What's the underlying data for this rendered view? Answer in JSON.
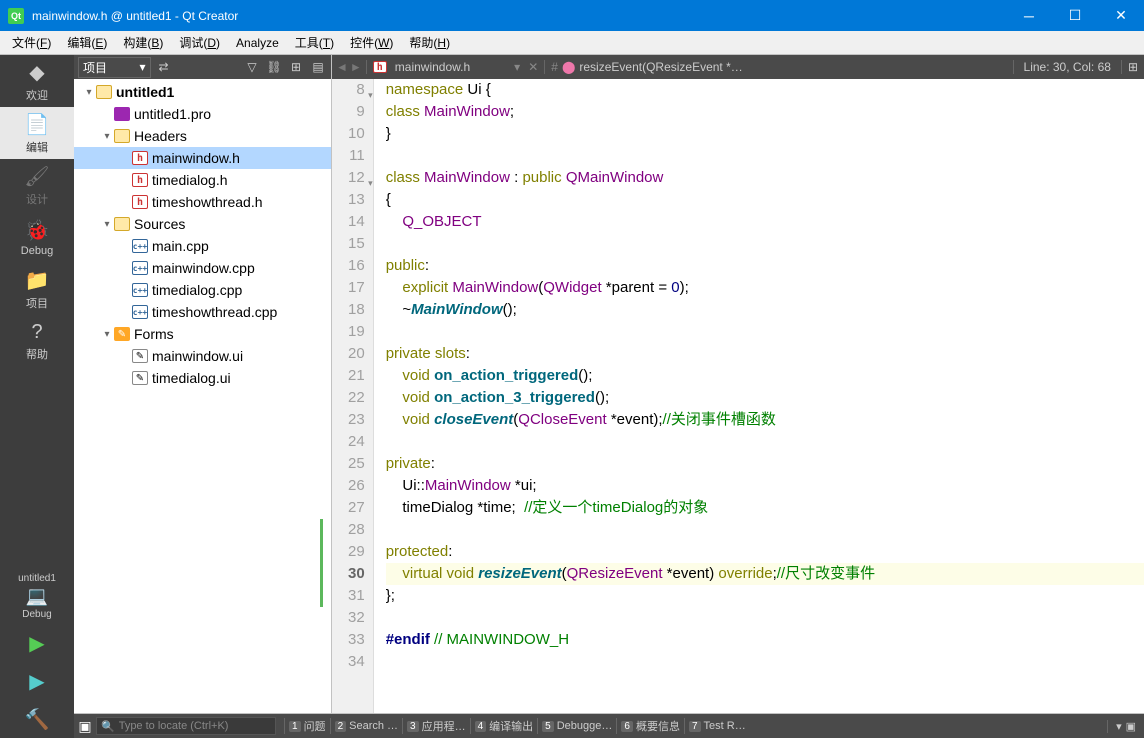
{
  "window": {
    "title": "mainwindow.h @ untitled1 - Qt Creator"
  },
  "menu": {
    "items": [
      "文件(F)",
      "编辑(E)",
      "构建(B)",
      "调试(D)",
      "Analyze",
      "工具(T)",
      "控件(W)",
      "帮助(H)"
    ]
  },
  "modes": {
    "items": [
      {
        "icon": "◆",
        "label": "欢迎",
        "id": "welcome"
      },
      {
        "icon": "📄",
        "label": "编辑",
        "id": "edit",
        "selected": true
      },
      {
        "icon": "🖌",
        "label": "设计",
        "id": "design",
        "dim": true
      },
      {
        "icon": "🐞",
        "label": "Debug",
        "id": "debug"
      },
      {
        "icon": "📁",
        "label": "项目",
        "id": "projects"
      },
      {
        "icon": "?",
        "label": "帮助",
        "id": "help"
      }
    ],
    "kit": "untitled1",
    "kit_config": "Debug",
    "run_btns": [
      "▶",
      "▶",
      "🔨"
    ]
  },
  "sidebar": {
    "title": "项目",
    "tree": [
      {
        "depth": 0,
        "chev": "▾",
        "icon": "folder",
        "label": "untitled1",
        "bold": true
      },
      {
        "depth": 1,
        "chev": "",
        "icon": "pro",
        "label": "untitled1.pro"
      },
      {
        "depth": 1,
        "chev": "▾",
        "icon": "folder",
        "label": "Headers"
      },
      {
        "depth": 2,
        "chev": "",
        "icon": "h",
        "label": "mainwindow.h",
        "selected": true
      },
      {
        "depth": 2,
        "chev": "",
        "icon": "h",
        "label": "timedialog.h"
      },
      {
        "depth": 2,
        "chev": "",
        "icon": "h",
        "label": "timeshowthread.h"
      },
      {
        "depth": 1,
        "chev": "▾",
        "icon": "folder",
        "label": "Sources"
      },
      {
        "depth": 2,
        "chev": "",
        "icon": "cpp",
        "label": "main.cpp"
      },
      {
        "depth": 2,
        "chev": "",
        "icon": "cpp",
        "label": "mainwindow.cpp"
      },
      {
        "depth": 2,
        "chev": "",
        "icon": "cpp",
        "label": "timedialog.cpp"
      },
      {
        "depth": 2,
        "chev": "",
        "icon": "cpp",
        "label": "timeshowthread.cpp"
      },
      {
        "depth": 1,
        "chev": "▾",
        "icon": "form",
        "label": "Forms"
      },
      {
        "depth": 2,
        "chev": "",
        "icon": "ui",
        "label": "mainwindow.ui"
      },
      {
        "depth": 2,
        "chev": "",
        "icon": "ui",
        "label": "timedialog.ui"
      }
    ]
  },
  "editor": {
    "filename": "mainwindow.h",
    "symbol": "resizeEvent(QResizeEvent *…",
    "position": "Line: 30, Col: 68",
    "first_line": 8,
    "current_line": 30,
    "lines": [
      {
        "fold": "▾",
        "tokens": [
          [
            "kw",
            "namespace"
          ],
          [
            "op",
            " Ui {"
          ]
        ]
      },
      {
        "tokens": [
          [
            "kw",
            "class"
          ],
          [
            "op",
            " "
          ],
          [
            "type",
            "MainWindow"
          ],
          [
            "op",
            ";"
          ]
        ]
      },
      {
        "tokens": [
          [
            "op",
            "}"
          ]
        ]
      },
      {
        "tokens": []
      },
      {
        "fold": "▾",
        "tokens": [
          [
            "kw",
            "class"
          ],
          [
            "op",
            " "
          ],
          [
            "type",
            "MainWindow"
          ],
          [
            "op",
            " : "
          ],
          [
            "kw",
            "public"
          ],
          [
            "op",
            " "
          ],
          [
            "type",
            "QMainWindow"
          ]
        ]
      },
      {
        "tokens": [
          [
            "op",
            "{"
          ]
        ]
      },
      {
        "tokens": [
          [
            "op",
            "    "
          ],
          [
            "type",
            "Q_OBJECT"
          ]
        ]
      },
      {
        "tokens": []
      },
      {
        "tokens": [
          [
            "kw",
            "public"
          ],
          [
            "op",
            ":"
          ]
        ]
      },
      {
        "tokens": [
          [
            "op",
            "    "
          ],
          [
            "kw",
            "explicit"
          ],
          [
            "op",
            " "
          ],
          [
            "type",
            "MainWindow"
          ],
          [
            "op",
            "("
          ],
          [
            "type",
            "QWidget"
          ],
          [
            "op",
            " *parent = "
          ],
          [
            "num",
            "0"
          ],
          [
            "op",
            ");"
          ]
        ]
      },
      {
        "tokens": [
          [
            "op",
            "    ~"
          ],
          [
            "func",
            "MainWindow"
          ],
          [
            "op",
            "();"
          ]
        ]
      },
      {
        "tokens": []
      },
      {
        "tokens": [
          [
            "kw",
            "private"
          ],
          [
            "op",
            " "
          ],
          [
            "kw",
            "slots"
          ],
          [
            "op",
            ":"
          ]
        ]
      },
      {
        "tokens": [
          [
            "op",
            "    "
          ],
          [
            "kw",
            "void"
          ],
          [
            "op",
            " "
          ],
          [
            "func2",
            "on_action_triggered"
          ],
          [
            "op",
            "();"
          ]
        ]
      },
      {
        "tokens": [
          [
            "op",
            "    "
          ],
          [
            "kw",
            "void"
          ],
          [
            "op",
            " "
          ],
          [
            "func2",
            "on_action_3_triggered"
          ],
          [
            "op",
            "();"
          ]
        ]
      },
      {
        "tokens": [
          [
            "op",
            "    "
          ],
          [
            "kw",
            "void"
          ],
          [
            "op",
            " "
          ],
          [
            "func",
            "closeEvent"
          ],
          [
            "op",
            "("
          ],
          [
            "type",
            "QCloseEvent"
          ],
          [
            "op",
            " *event);"
          ],
          [
            "cmt",
            "//关闭事件槽函数"
          ]
        ]
      },
      {
        "tokens": []
      },
      {
        "tokens": [
          [
            "kw",
            "private"
          ],
          [
            "op",
            ":"
          ]
        ]
      },
      {
        "tokens": [
          [
            "op",
            "    Ui::"
          ],
          [
            "type",
            "MainWindow"
          ],
          [
            "op",
            " *ui;"
          ]
        ]
      },
      {
        "tokens": [
          [
            "op",
            "    timeDialog *time;  "
          ],
          [
            "cmt",
            "//定义一个timeDialog的对象"
          ]
        ]
      },
      {
        "mod": true,
        "tokens": []
      },
      {
        "mod": true,
        "tokens": [
          [
            "kw",
            "protected"
          ],
          [
            "op",
            ":"
          ]
        ]
      },
      {
        "mod": true,
        "current": true,
        "tokens": [
          [
            "op",
            "    "
          ],
          [
            "kw",
            "virtual"
          ],
          [
            "op",
            " "
          ],
          [
            "kw",
            "void"
          ],
          [
            "op",
            " "
          ],
          [
            "func",
            "resizeEvent"
          ],
          [
            "op",
            "("
          ],
          [
            "type",
            "QResizeEvent"
          ],
          [
            "op",
            " *event) "
          ],
          [
            "kw",
            "override"
          ],
          [
            "op",
            ";"
          ],
          [
            "cmt",
            "//尺寸改变事件"
          ]
        ]
      },
      {
        "mod": true,
        "tokens": [
          [
            "op",
            "};"
          ]
        ]
      },
      {
        "tokens": []
      },
      {
        "tokens": [
          [
            "pp",
            "#endif"
          ],
          [
            "op",
            " "
          ],
          [
            "cmt",
            "// MAINWINDOW_H"
          ]
        ]
      },
      {
        "tokens": []
      }
    ]
  },
  "status": {
    "locator_placeholder": "Type to locate (Ctrl+K)",
    "panes": [
      "问题",
      "Search …",
      "应用程…",
      "编译输出",
      "Debugge…",
      "概要信息",
      "Test R…"
    ]
  }
}
